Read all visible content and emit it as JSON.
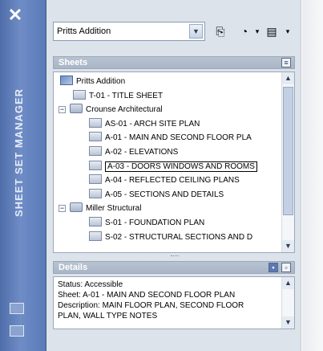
{
  "palette": {
    "title_strip": "#587bb8",
    "panel_bg": "#dde3ea",
    "section_header": "#aab6c7"
  },
  "window": {
    "title": "SHEET SET MANAGER",
    "close_glyph": "✕"
  },
  "toolbar": {
    "sheet_set_value": "Pritts Addition",
    "icons": [
      "sheet-set-icon",
      "publish-icon",
      "view-icon"
    ]
  },
  "sheets_section": {
    "header": "Sheets",
    "tree": [
      {
        "label": "Pritts Addition",
        "type": "set"
      },
      {
        "label": "T-01 - TITLE SHEET",
        "type": "sheet"
      },
      {
        "label": "Crounse Architectural",
        "type": "subset",
        "expander": "−"
      },
      {
        "label": "AS-01 - ARCH SITE PLAN",
        "type": "sheet"
      },
      {
        "label": "A-01 - MAIN AND SECOND FLOOR PLA",
        "type": "sheet"
      },
      {
        "label": "A-02 - ELEVATIONS",
        "type": "sheet"
      },
      {
        "label": "A-03 - DOORS WINDOWS AND ROOMS",
        "type": "sheet",
        "selected": true
      },
      {
        "label": "A-04 - REFLECTED CEILING PLANS",
        "type": "sheet"
      },
      {
        "label": "A-05 - SECTIONS AND DETAILS",
        "type": "sheet"
      },
      {
        "label": "Miller Structural",
        "type": "subset",
        "expander": "−"
      },
      {
        "label": "S-01 - FOUNDATION PLAN",
        "type": "sheet"
      },
      {
        "label": "S-02 - STRUCTURAL SECTIONS AND D",
        "type": "sheet"
      }
    ]
  },
  "details_section": {
    "header": "Details",
    "lines": [
      "Status: Accessible",
      "Sheet: A-01 - MAIN AND SECOND FLOOR PLAN",
      "Description: MAIN FLOOR PLAN, SECOND FLOOR",
      "PLAN, WALL TYPE NOTES"
    ]
  }
}
